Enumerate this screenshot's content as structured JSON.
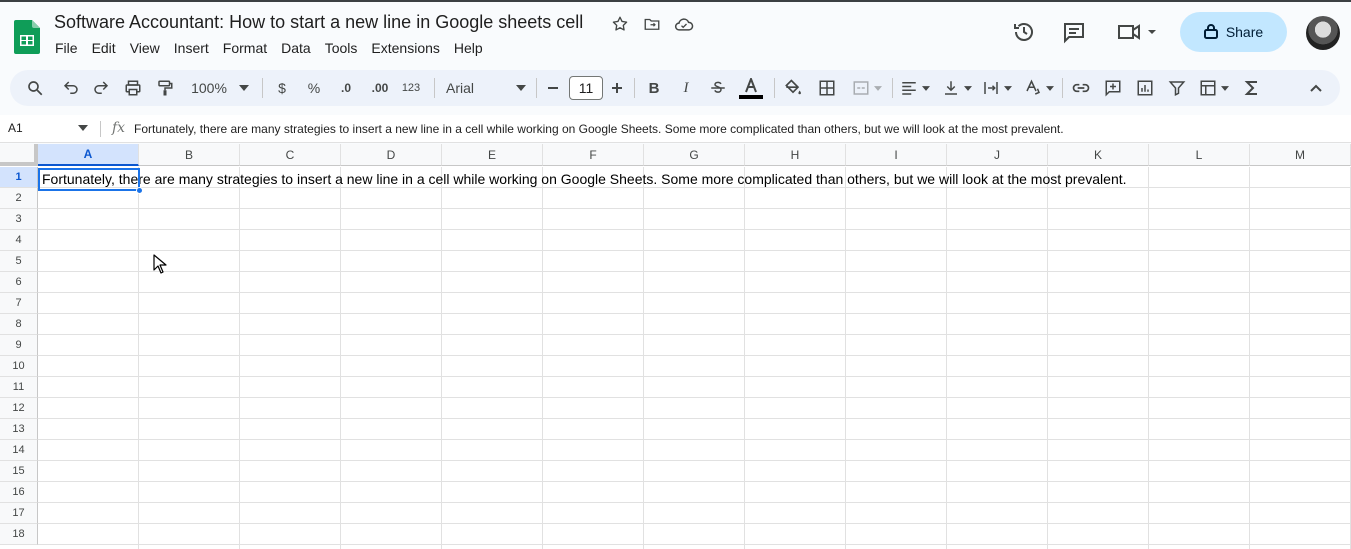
{
  "app": {
    "title": "Software Accountant: How to start a new line in Google sheets cell",
    "accent_color": "#0b57d0",
    "logo_color": "#0f9d58"
  },
  "title_icons": [
    "star-icon",
    "move-to-folder-icon",
    "cloud-saved-icon"
  ],
  "menu": [
    "File",
    "Edit",
    "View",
    "Insert",
    "Format",
    "Data",
    "Tools",
    "Extensions",
    "Help"
  ],
  "header_right": {
    "icons": [
      "version-history-icon",
      "comments-icon",
      "meet-icon"
    ],
    "share_label": "Share",
    "share_icon": "lock-icon"
  },
  "toolbar": {
    "zoom": "100%",
    "currency": "$",
    "percent": "%",
    "decrease_decimal": ".0",
    "increase_decimal": ".00",
    "number_format": "123",
    "font": "Arial",
    "font_size": "11",
    "bold": "B",
    "italic": "I"
  },
  "formula_bar": {
    "name_box": "A1",
    "fx": "fx",
    "content": "Fortunately, there are many strategies to insert a new line in a cell while working on Google Sheets. Some more complicated than others, but we will look at the most prevalent."
  },
  "grid": {
    "columns": [
      "A",
      "B",
      "C",
      "D",
      "E",
      "F",
      "G",
      "H",
      "I",
      "J",
      "K",
      "L",
      "M"
    ],
    "rows": [
      "1",
      "2",
      "3",
      "4",
      "5",
      "6",
      "7",
      "8",
      "9",
      "10",
      "11",
      "12",
      "13",
      "14",
      "15",
      "16",
      "17",
      "18"
    ],
    "selected_cell": "A1",
    "cell_a1": "Fortunately, there are many strategies to insert a new line in a cell while working on Google Sheets. Some more complicated than others, but we will look at the most prevalent."
  }
}
